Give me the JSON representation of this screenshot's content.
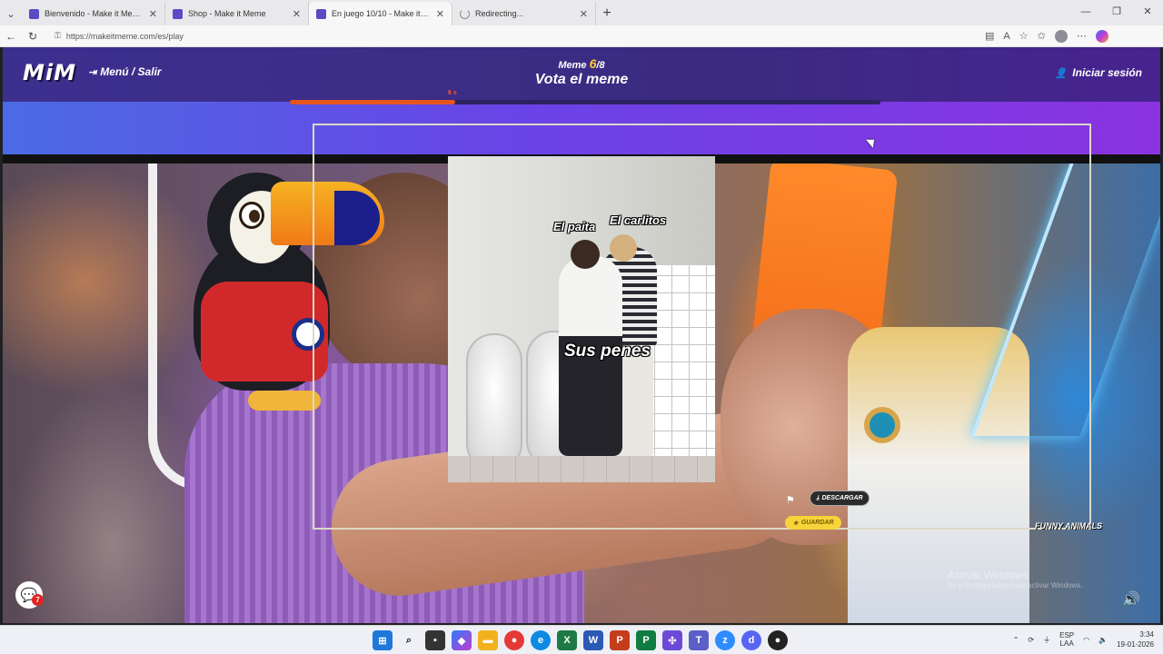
{
  "browser": {
    "tabs": [
      {
        "label": "Bienvenido - Make it Meme",
        "active": false
      },
      {
        "label": "Shop - Make it Meme",
        "active": false
      },
      {
        "label": "En juego 10/10 - Make it Meme",
        "active": true
      },
      {
        "label": "Redirecting...",
        "active": false
      }
    ],
    "url": "https://makeitmeme.com/es/play"
  },
  "header": {
    "logo": "MiM",
    "menu_label": "Menú / Salir",
    "round_prefix": "Meme ",
    "round_current": "6",
    "round_total": "/8",
    "title": "Vota el meme",
    "login_label": "Iniciar sesión",
    "timer_label": "6 s",
    "timer_progress": 0.28
  },
  "meme": {
    "top_text": "...",
    "caption_left": "El paita",
    "caption_right": "El carlitos",
    "caption_main": "Sus penes"
  },
  "actions": {
    "download_label": "DESCARGAR",
    "save_label": "GUARDAR",
    "bg_label": "FUNNY ANIMALS"
  },
  "chat": {
    "badge": "7"
  },
  "watermark": {
    "line1": "Activar Windows",
    "line2": "Ve a Configuración para activar Windows."
  },
  "taskbar": {
    "lang_line1": "ESP",
    "lang_line2": "LAA",
    "time": "3:34",
    "date": "19-01-2026"
  },
  "colors": {
    "header": "#3d2f8e",
    "band_start": "#4b6be4",
    "band_end": "#8a33e0",
    "timer_fill": "#e8541e",
    "round_accent": "#ffcc33",
    "save_button": "#f6d43a"
  },
  "icons": [
    "exit-icon",
    "user-icon",
    "flag-icon",
    "download-icon",
    "star-icon",
    "chat-icon",
    "sound-icon"
  ]
}
